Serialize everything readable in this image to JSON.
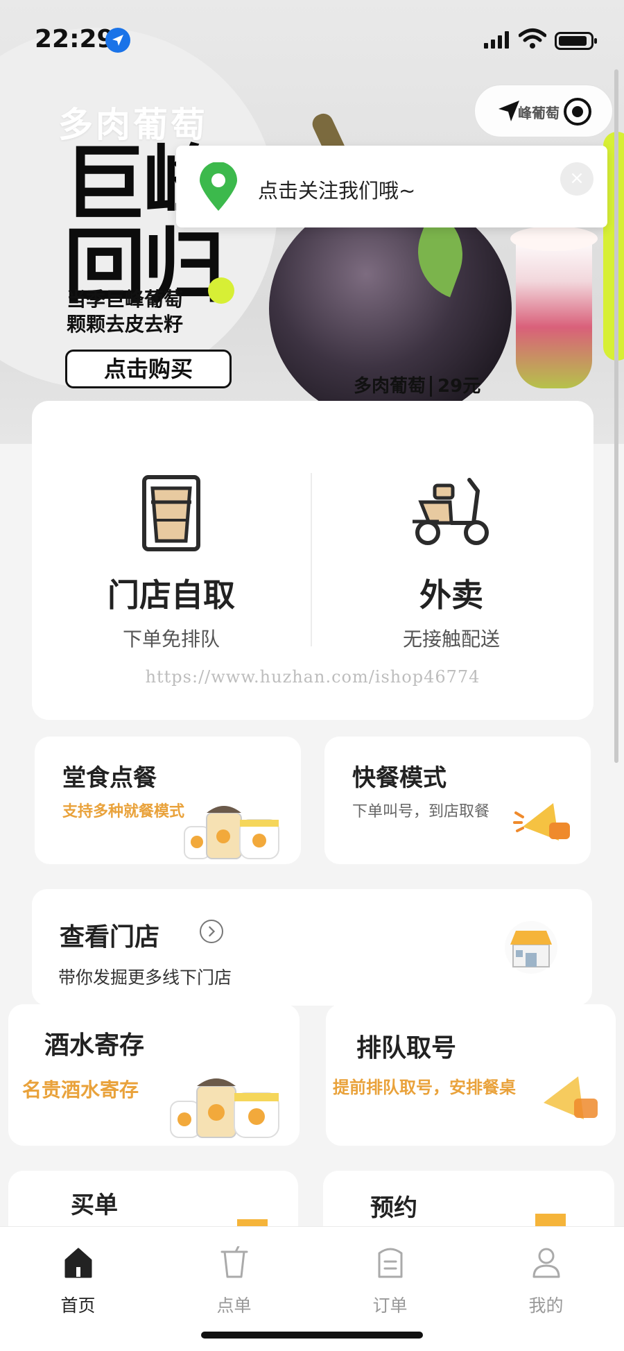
{
  "status_bar": {
    "time": "22:29"
  },
  "banner": {
    "subtitle": "多肉葡萄",
    "title": "巨峰回归",
    "desc_line1": "当季巨峰葡萄",
    "desc_line2": "颗颗去皮去籽",
    "buy_label": "点击购买",
    "product_name": "多肉葡萄",
    "price": "29元",
    "capsule_tag": "峰葡萄"
  },
  "toast": {
    "text": "点击关注我们哦~",
    "close_glyph": "×"
  },
  "main_options": {
    "pickup": {
      "title": "门店自取",
      "subtitle": "下单免排队"
    },
    "delivery": {
      "title": "外卖",
      "subtitle": "无接触配送"
    },
    "watermark": "https://www.huzhan.com/ishop46774"
  },
  "cards": {
    "dine_in": {
      "title": "堂食点餐",
      "subtitle": "支持多种就餐模式"
    },
    "fast_food": {
      "title": "快餐模式",
      "subtitle": "下单叫号，到店取餐"
    },
    "wine_storage": {
      "title": "酒水寄存",
      "subtitle": "名贵酒水寄存"
    },
    "queue": {
      "title": "排队取号",
      "subtitle": "提前排队取号，安排餐桌"
    },
    "pay_bill": {
      "title": "买单"
    },
    "reserve": {
      "title": "预约"
    }
  },
  "store": {
    "title": "查看门店",
    "subtitle": "带你发掘更多线下门店"
  },
  "tabbar": {
    "items": [
      {
        "label": "首页",
        "active": true
      },
      {
        "label": "点单",
        "active": false
      },
      {
        "label": "订单",
        "active": false
      },
      {
        "label": "我的",
        "active": false
      }
    ]
  },
  "colors": {
    "accent": "#e9a23b",
    "lime": "#d7ef35",
    "pin_green": "#3cb94c"
  }
}
